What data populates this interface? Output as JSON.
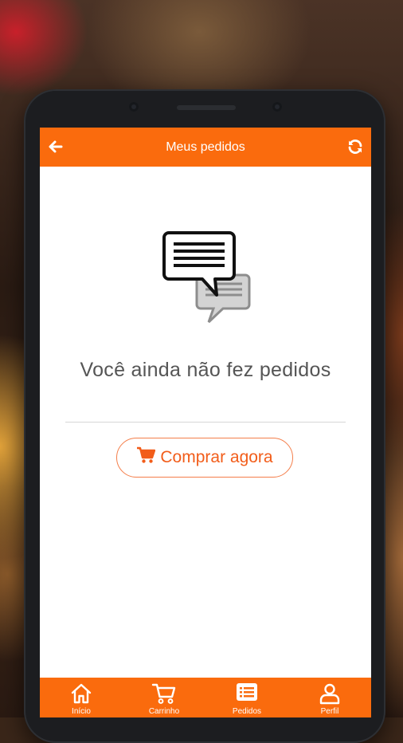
{
  "topbar": {
    "title": "Meus pedidos",
    "back_icon": "arrow-left-icon",
    "refresh_icon": "refresh-icon"
  },
  "empty_state": {
    "icon": "chat-bubbles-icon",
    "message": "Você ainda não fez pedidos"
  },
  "buy_button": {
    "icon": "shopping-cart-icon",
    "label": "Comprar agora"
  },
  "bottom_nav": {
    "items": [
      {
        "label": "Início",
        "icon": "home-icon"
      },
      {
        "label": "Carrinho",
        "icon": "cart-icon"
      },
      {
        "label": "Pedidos",
        "icon": "list-icon"
      },
      {
        "label": "Perfil",
        "icon": "user-icon"
      }
    ]
  },
  "colors": {
    "brand_orange": "#fa6b0d",
    "button_text": "#f25d1a",
    "message_text": "#555555"
  }
}
